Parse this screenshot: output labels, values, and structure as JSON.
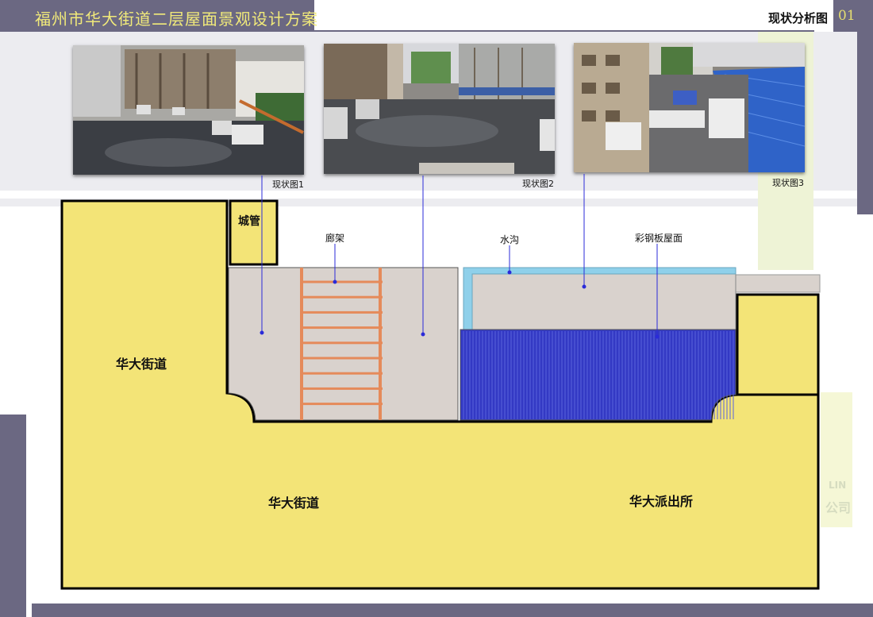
{
  "header": {
    "title": "福州市华大街道二层屋面景观设计方案",
    "section_title": "现状分析图",
    "page_number": "01"
  },
  "photos": [
    {
      "label": "现状图1"
    },
    {
      "label": "现状图2"
    },
    {
      "label": "现状图3"
    }
  ],
  "plan": {
    "areas": {
      "left": "华大街道",
      "bottom": "华大街道",
      "right": "华大派出所",
      "small_box": "城管"
    },
    "annotations": {
      "pergola": "廊架",
      "gutter": "水沟",
      "steel_roof": "彩钢板屋面"
    }
  },
  "watermark": {
    "line1": "LIN",
    "line2": "公司"
  },
  "colors": {
    "frame": "#6b6882",
    "title_text": "#f1ea7a",
    "building_yellow": "#f3e477",
    "roof_beige": "#d9d2cd",
    "steel_blue": "#3339c4",
    "water_cyan": "#8fd0ea",
    "pergola_orange": "#e58a5a",
    "leader_line": "#2b2bd9"
  }
}
